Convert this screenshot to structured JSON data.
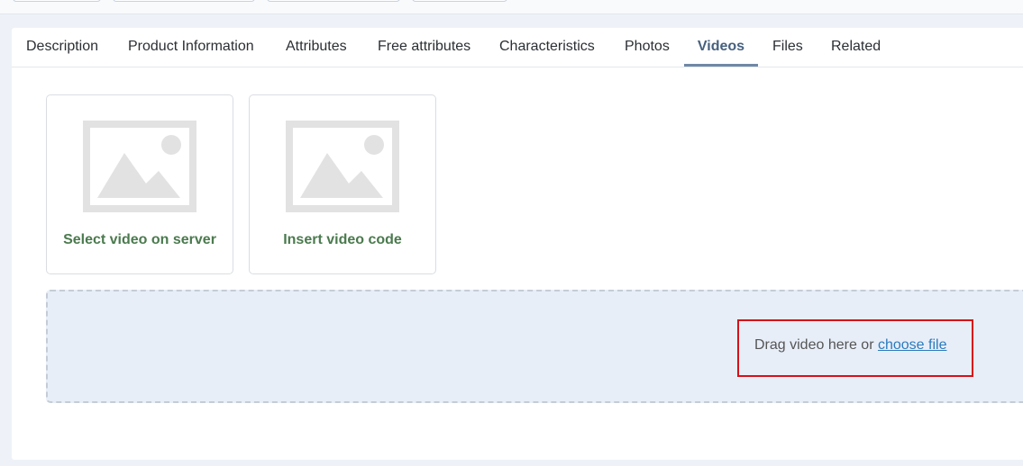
{
  "tabs": [
    {
      "label": "Description",
      "active": false
    },
    {
      "label": "Product Information",
      "active": false
    },
    {
      "label": "Attributes",
      "active": false
    },
    {
      "label": "Free attributes",
      "active": false
    },
    {
      "label": "Characteristics",
      "active": false
    },
    {
      "label": "Photos",
      "active": false
    },
    {
      "label": "Videos",
      "active": true
    },
    {
      "label": "Files",
      "active": false
    },
    {
      "label": "Related",
      "active": false
    }
  ],
  "cards": {
    "select_server": {
      "label": "Select video on server",
      "icon": "image-placeholder-icon"
    },
    "insert_code": {
      "label": "Insert video code",
      "icon": "image-placeholder-icon"
    }
  },
  "dropzone": {
    "text": "Drag video here or",
    "link": "choose file"
  },
  "colors": {
    "active_tab": "#47607e",
    "card_label": "#4b7a4e",
    "dropzone_bg": "#e8eef8",
    "highlight_border": "#d6101a",
    "link": "#2b7bbd"
  }
}
